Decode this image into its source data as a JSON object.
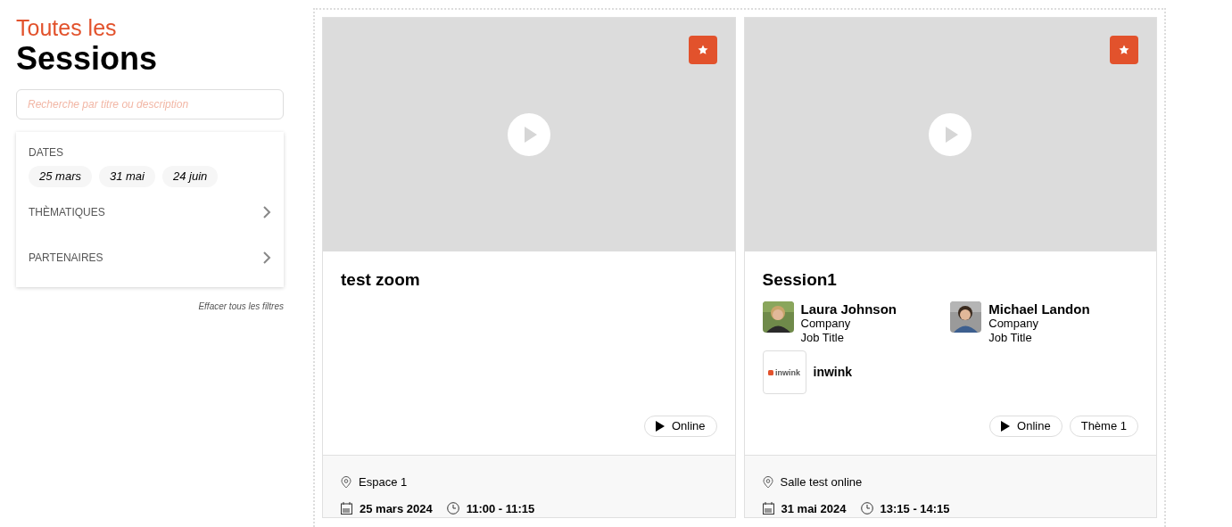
{
  "header": {
    "kicker": "Toutes les",
    "title": "Sessions"
  },
  "search": {
    "placeholder": "Recherche par titre ou description"
  },
  "filters": {
    "dates_label": "DATES",
    "dates": [
      "25 mars",
      "31 mai",
      "24 juin"
    ],
    "sections": [
      {
        "label": "THÈMATIQUES",
        "expanded": false
      },
      {
        "label": "PARTENAIRES",
        "expanded": false
      }
    ],
    "clear": "Effacer tous les filtres"
  },
  "sessions": [
    {
      "title": "test zoom",
      "tags": [
        {
          "kind": "online",
          "label": "Online"
        }
      ],
      "location": "Espace 1",
      "date": "25 mars 2024",
      "time": "11:00 - 11:15"
    },
    {
      "title": "Session1",
      "speakers": [
        {
          "name": "Laura Johnson",
          "company": "Company",
          "job": "Job Title"
        },
        {
          "name": "Michael Landon",
          "company": "Company",
          "job": "Job Title"
        }
      ],
      "partners": [
        {
          "name": "inwink",
          "logo_text": "inwink"
        }
      ],
      "tags": [
        {
          "kind": "online",
          "label": "Online"
        },
        {
          "kind": "theme",
          "label": "Thème 1"
        }
      ],
      "location": "Salle test online",
      "date": "31 mai 2024",
      "time": "13:15 - 14:15"
    }
  ]
}
